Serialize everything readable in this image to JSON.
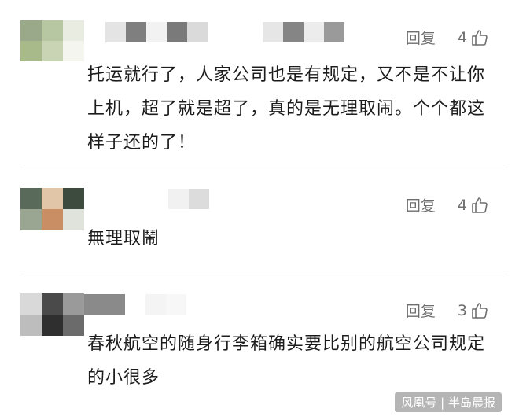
{
  "comments": [
    {
      "reply_label": "回复",
      "likes": "4",
      "text": "托运就行了，人家公司也是有规定，又不是不让你上机，超了就是超了，真的是无理取闹。个个都这样子还的了！"
    },
    {
      "reply_label": "回复",
      "likes": "4",
      "text": "無理取鬧"
    },
    {
      "reply_label": "回复",
      "likes": "3",
      "text": "春秋航空的随身行李箱确实要比别的航空公司规定的小很多"
    }
  ],
  "watermark": "风凰号 | 半岛晨报",
  "icons": {
    "like": "thumbs-up-icon"
  }
}
